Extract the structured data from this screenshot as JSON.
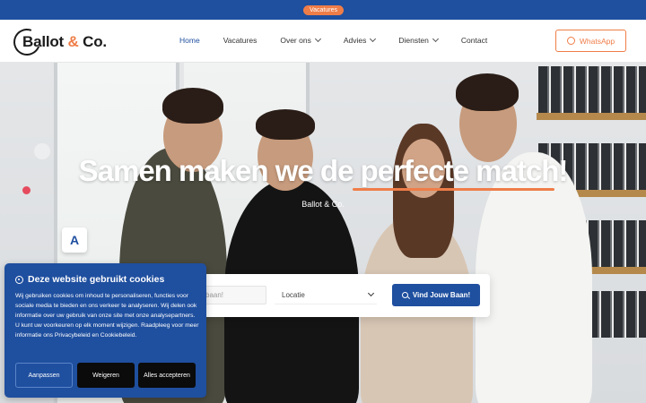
{
  "topbar": {
    "badge": "Vacatures"
  },
  "logo": {
    "text_main": "Ballot ",
    "text_amp": "&",
    "text_tail": " Co."
  },
  "nav": {
    "items": [
      {
        "label": "Home",
        "active": true,
        "dropdown": false
      },
      {
        "label": "Vacatures",
        "active": false,
        "dropdown": false
      },
      {
        "label": "Over ons",
        "active": false,
        "dropdown": true
      },
      {
        "label": "Advies",
        "active": false,
        "dropdown": true
      },
      {
        "label": "Diensten",
        "active": false,
        "dropdown": true
      },
      {
        "label": "Contact",
        "active": false,
        "dropdown": false
      }
    ],
    "cta": "WhatsApp"
  },
  "hero": {
    "title": "Samen maken we de perfecte match!",
    "subtitle": "Ballot & Co."
  },
  "search": {
    "job_placeholder": "baan!",
    "location_value": "Locatie",
    "button": "Vind Jouw Baan!"
  },
  "cookie": {
    "title": "Deze website gebruikt cookies",
    "body": "Wij gebruiken cookies om inhoud te personaliseren, functies voor sociale media te bieden en ons verkeer te analyseren. Wij delen ook informatie over uw gebruik van onze site met onze analysepartners. U kunt uw voorkeuren op elk moment wijzigen. Raadpleeg voor meer informatie ons Privacybeleid en Cookiebeleid.",
    "buttons": {
      "customize": "Aanpassen",
      "decline": "Weigeren",
      "accept": "Alles accepteren"
    }
  },
  "colors": {
    "brand_blue": "#1f4f9f",
    "accent_orange": "#ef7d48",
    "dark": "#0b0b0b"
  },
  "icons": [
    "whatsapp-icon",
    "chevron-down-icon",
    "search-icon",
    "cookie-icon",
    "app-badge-icon"
  ]
}
